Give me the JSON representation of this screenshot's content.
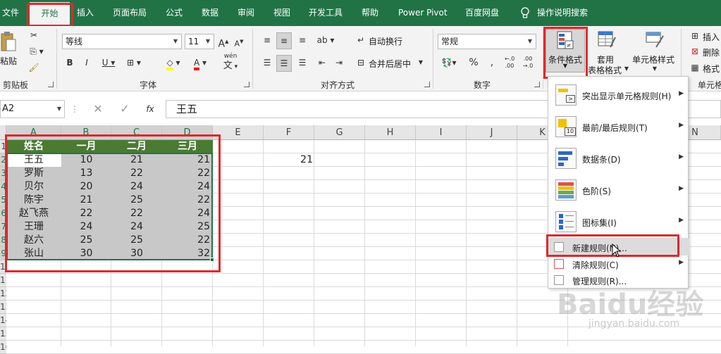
{
  "tabs": [
    "文件",
    "开始",
    "插入",
    "页面布局",
    "公式",
    "数据",
    "审阅",
    "视图",
    "开发工具",
    "帮助",
    "Power Pivot",
    "百度网盘",
    "操作说明搜索"
  ],
  "ribbon": {
    "paste_label": "粘贴",
    "clipboard_label": "剪贴板",
    "font_name": "等线",
    "font_size": "11",
    "font_label": "字体",
    "wen": "wén",
    "wen_char": "文",
    "wrap_text": "自动换行",
    "merge_center": "合并后居中",
    "alignment_label": "对齐方式",
    "number_format": "常规",
    "number_label": "数字",
    "cond_format": "条件格式",
    "table_format_1": "套用",
    "table_format_2": "表格格式",
    "cell_style": "单元格样式",
    "insert": "插入",
    "delete": "删除",
    "format": "格式",
    "cells_label": "单元格"
  },
  "formula_bar": {
    "name_box": "A2",
    "formula": "王五",
    "fx": "fx"
  },
  "columns": [
    "A",
    "B",
    "C",
    "D",
    "E",
    "F",
    "G",
    "H",
    "I",
    "J",
    "K",
    "N"
  ],
  "row_numbers": [
    "1",
    "2",
    "3",
    "4",
    "5",
    "6",
    "7",
    "8",
    "9",
    "10",
    "11",
    "12",
    "13",
    "14",
    "15",
    "16"
  ],
  "table": {
    "header": [
      "姓名",
      "一月",
      "二月",
      "三月"
    ],
    "rows": [
      [
        "王五",
        "10",
        "21",
        "21"
      ],
      [
        "罗斯",
        "13",
        "22",
        "22"
      ],
      [
        "贝尔",
        "20",
        "24",
        "24"
      ],
      [
        "陈宇",
        "21",
        "25",
        "22"
      ],
      [
        "赵飞燕",
        "22",
        "22",
        "24"
      ],
      [
        "王珊",
        "24",
        "24",
        "25"
      ],
      [
        "赵六",
        "25",
        "25",
        "22"
      ],
      [
        "张山",
        "30",
        "30",
        "32"
      ]
    ]
  },
  "f2_value": "21",
  "menu": {
    "items": [
      "突出显示单元格规则(H)",
      "最前/最后规则(T)",
      "数据条(D)",
      "色阶(S)",
      "图标集(I)"
    ],
    "icon_text_2": "10",
    "new_rule": "新建规则(N)...",
    "clear_rules": "清除规则(C)",
    "manage_rules": "管理规则(R)..."
  },
  "watermark": {
    "logo": "Baidu经验",
    "url": "jingyan.baidu.com"
  },
  "colors": {
    "excel_green": "#217346",
    "highlight_red": "#e0282d",
    "table_header": "#4b7a33",
    "selection_gray": "#c8c8c8"
  }
}
